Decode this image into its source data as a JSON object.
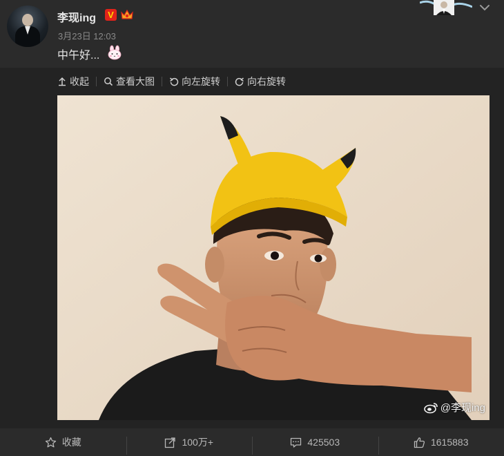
{
  "post": {
    "username": "李现ing",
    "verified_badge": "V",
    "timestamp": "3月23日 12:03",
    "text": "中午好...",
    "emoji": "bunny-emoji"
  },
  "image_toolbar": {
    "collapse": "收起",
    "view_large": "查看大图",
    "rotate_left": "向左旋转",
    "rotate_right": "向右旋转"
  },
  "photo": {
    "watermark": "@李现ing"
  },
  "footer": {
    "favorite": "收藏",
    "repost_count": "100万+",
    "comment_count": "425503",
    "like_count": "1615883"
  },
  "colors": {
    "background": "#232323",
    "header_bg": "#2b2b2b",
    "verified_red": "#e2231a",
    "hat_yellow": "#f2c214"
  }
}
